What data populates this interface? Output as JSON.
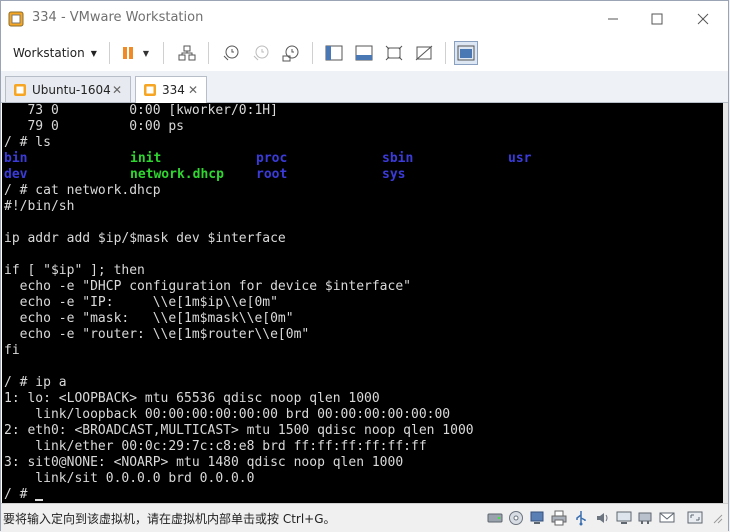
{
  "window": {
    "title": "334 - VMware Workstation"
  },
  "toolbar": {
    "workstation_menu_label": "Workstation"
  },
  "tabs": [
    {
      "label": "Ubuntu-1604",
      "active": false
    },
    {
      "label": "334",
      "active": true
    }
  ],
  "terminal": {
    "lines": [
      "   73 0         0:00 [kworker/0:1H]",
      "   79 0         0:00 ps",
      "/ # ls",
      "",
      "",
      "/ # cat network.dhcp",
      "#!/bin/sh",
      "",
      "ip addr add $ip/$mask dev $interface",
      "",
      "if [ \"$ip\" ]; then",
      "  echo -e \"DHCP configuration for device $interface\"",
      "  echo -e \"IP:     \\\\e[1m$ip\\\\e[0m\"",
      "  echo -e \"mask:   \\\\e[1m$mask\\\\e[0m\"",
      "  echo -e \"router: \\\\e[1m$router\\\\e[0m\"",
      "fi",
      "",
      "/ # ip a",
      "1: lo: <LOOPBACK> mtu 65536 qdisc noop qlen 1000",
      "    link/loopback 00:00:00:00:00:00 brd 00:00:00:00:00:00",
      "2: eth0: <BROADCAST,MULTICAST> mtu 1500 qdisc noop qlen 1000",
      "    link/ether 00:0c:29:7c:c8:e8 brd ff:ff:ff:ff:ff:ff",
      "3: sit0@NONE: <NOARP> mtu 1480 qdisc noop qlen 1000",
      "    link/sit 0.0.0.0 brd 0.0.0.0",
      "/ # "
    ],
    "ls_output": [
      {
        "name": "bin",
        "kind": "dir"
      },
      {
        "name": "init",
        "kind": "exec"
      },
      {
        "name": "proc",
        "kind": "dir"
      },
      {
        "name": "sbin",
        "kind": "dir"
      },
      {
        "name": "usr",
        "kind": "dir"
      },
      {
        "name": "dev",
        "kind": "dir"
      },
      {
        "name": "network.dhcp",
        "kind": "exec"
      },
      {
        "name": "root",
        "kind": "dir"
      },
      {
        "name": "sys",
        "kind": "dir"
      }
    ],
    "dir_color": "#3b3bd9",
    "exec_color": "#2fd62f",
    "text_color": "#d9d9d9",
    "background": "#000000"
  },
  "statusbar": {
    "hint": "要将输入定向到该虚拟机，请在虚拟机内部单击或按 Ctrl+G。",
    "icons": [
      "hard-disk-icon",
      "cd-dvd-icon",
      "network-icon",
      "printer-icon",
      "usb-icon",
      "sound-icon",
      "display-icon",
      "network-adapter-icon",
      "message-icon",
      "fullscreen-icon"
    ]
  },
  "colors": {
    "accent": "#f08a24",
    "tab_border": "#b8bec8"
  }
}
